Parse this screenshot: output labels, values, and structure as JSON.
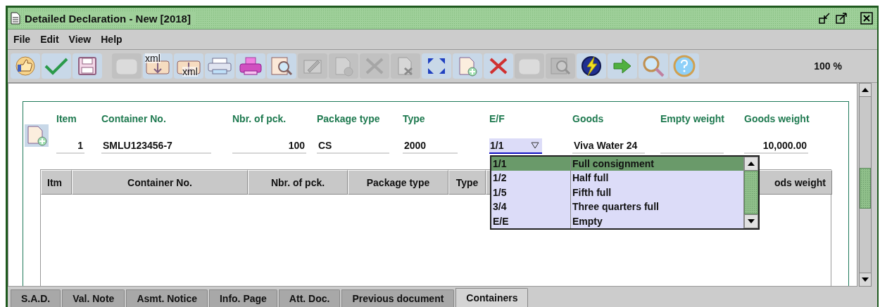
{
  "window": {
    "title": "Detailed Declaration - New [2018]"
  },
  "menu": [
    "File",
    "Edit",
    "View",
    "Help"
  ],
  "toolbar": [
    {
      "disabled": false
    },
    {
      "disabled": false
    },
    {
      "disabled": false
    },
    {
      "disabled": true
    },
    {
      "disabled": false,
      "label": "xml"
    },
    {
      "disabled": false,
      "label": "xml"
    },
    {
      "disabled": false
    },
    {
      "disabled": false
    },
    {
      "disabled": false
    },
    {
      "disabled": true
    },
    {
      "disabled": true
    },
    {
      "disabled": true
    },
    {
      "disabled": true
    },
    {
      "disabled": false
    },
    {
      "disabled": false
    },
    {
      "disabled": false
    },
    {
      "disabled": true
    },
    {
      "disabled": true
    },
    {
      "disabled": false
    },
    {
      "disabled": false
    },
    {
      "disabled": false
    },
    {
      "disabled": false
    }
  ],
  "zoom": "100 %",
  "form": {
    "fields": [
      {
        "label": "Item",
        "value": "1",
        "kind": "number"
      },
      {
        "label": "Container No.",
        "value": "SMLU123456-7",
        "kind": "text"
      },
      {
        "label": "Nbr. of pck.",
        "value": "100",
        "kind": "number"
      },
      {
        "label": "Package type",
        "value": "CS",
        "kind": "text"
      },
      {
        "label": "Type",
        "value": "2000",
        "kind": "text"
      },
      {
        "label": "E/F",
        "value": "1/1",
        "kind": "select",
        "expanded": true
      },
      {
        "label": "Goods",
        "value": "Viva Water 24",
        "kind": "text"
      },
      {
        "label": "Empty weight",
        "kind": "text"
      },
      {
        "label": "Goods weight",
        "value": "10,000.00",
        "kind": "number"
      }
    ],
    "options": [
      {
        "code": "1/1",
        "description": "Full consignment",
        "selected": true
      },
      {
        "code": "1/2",
        "description": "Half full",
        "selected": false
      },
      {
        "code": "1/5",
        "description": "Fifth full",
        "selected": false
      },
      {
        "code": "3/4",
        "description": "Three quarters full",
        "selected": false
      },
      {
        "code": "E/E",
        "description": "Empty",
        "selected": false
      }
    ]
  },
  "table": {
    "columns": [
      "Itm",
      "Container No.",
      "Nbr. of pck.",
      "Package type",
      "Type",
      "ods weight"
    ]
  },
  "tabs": [
    {
      "label": "S.A.D.",
      "selected": false
    },
    {
      "label": "Val. Note",
      "selected": false
    },
    {
      "label": "Asmt. Notice",
      "selected": false
    },
    {
      "label": "Info. Page",
      "selected": false
    },
    {
      "label": "Att. Doc.",
      "selected": false
    },
    {
      "label": "Previous document",
      "selected": false
    },
    {
      "label": "Containers",
      "selected": true
    }
  ]
}
